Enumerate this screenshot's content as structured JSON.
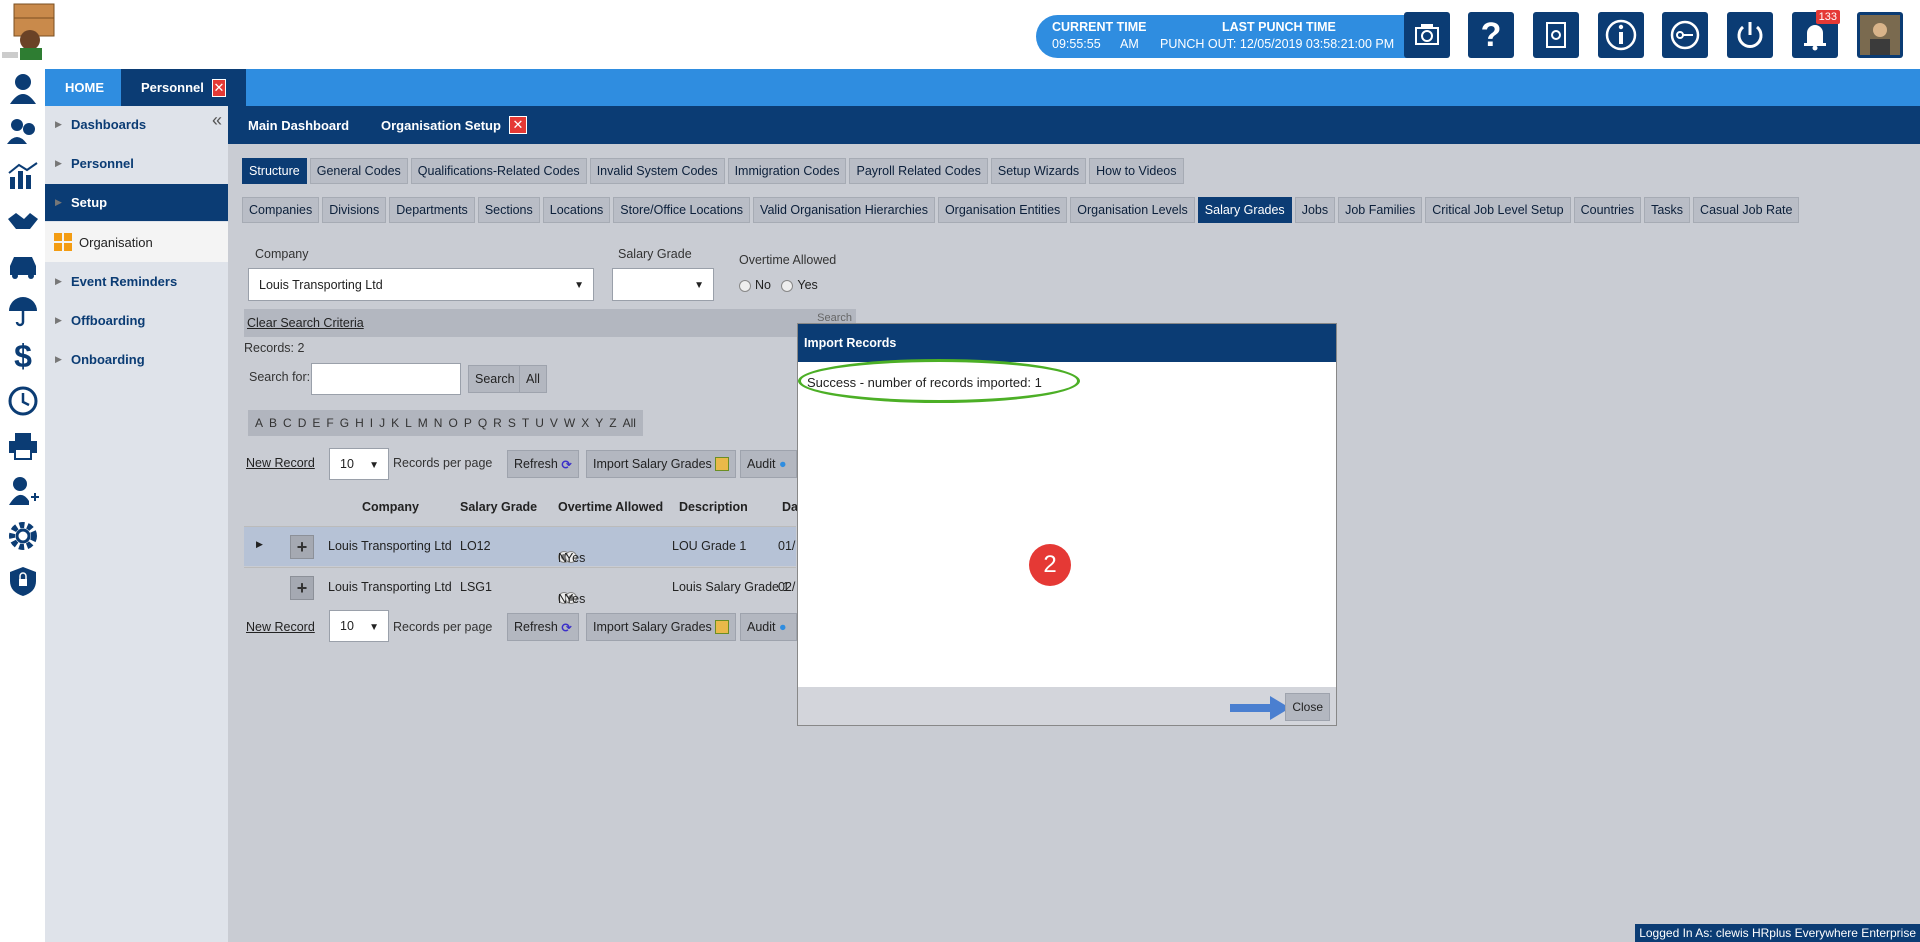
{
  "header": {
    "current_time_label": "CURRENT TIME",
    "current_time": "09:55:55",
    "current_ampm": "AM",
    "last_punch_label": "LAST PUNCH TIME",
    "last_punch": "PUNCH OUT: 12/05/2019 03:58:21:00 PM",
    "notification_count": "133"
  },
  "top_tabs": {
    "home": "HOME",
    "personnel": "Personnel"
  },
  "sidebar": {
    "items": [
      "Dashboards",
      "Personnel",
      "Setup",
      "Organisation",
      "Event Reminders",
      "Offboarding",
      "Onboarding"
    ]
  },
  "sub_tabs": {
    "main": "Main Dashboard",
    "org": "Organisation Setup"
  },
  "code_tabs": [
    "Structure",
    "General Codes",
    "Qualifications-Related Codes",
    "Invalid System Codes",
    "Immigration Codes",
    "Payroll Related Codes",
    "Setup Wizards",
    "How to Videos"
  ],
  "structure_tabs": [
    "Companies",
    "Divisions",
    "Departments",
    "Sections",
    "Locations",
    "Store/Office Locations",
    "Valid Organisation Hierarchies",
    "Organisation Entities",
    "Organisation Levels",
    "Salary Grades",
    "Jobs",
    "Job Families",
    "Critical Job Level Setup",
    "Countries",
    "Tasks",
    "Casual Job Rate"
  ],
  "filters": {
    "company_label": "Company",
    "company_value": "Louis Transporting Ltd",
    "grade_label": "Salary Grade",
    "overtime_label": "Overtime Allowed",
    "no": "No",
    "yes": "Yes",
    "clear": "Clear Search Criteria",
    "search_partial": "Search",
    "records": "Records:  2",
    "search_for": "Search for:",
    "search_btn": "Search",
    "all_btn": "All"
  },
  "alphabet": [
    "A",
    "B",
    "C",
    "D",
    "E",
    "F",
    "G",
    "H",
    "I",
    "J",
    "K",
    "L",
    "M",
    "N",
    "O",
    "P",
    "Q",
    "R",
    "S",
    "T",
    "U",
    "V",
    "W",
    "X",
    "Y",
    "Z",
    "All"
  ],
  "toolbar": {
    "new_record": "New Record",
    "per_page_value": "10",
    "per_page_label": "Records per page",
    "refresh": "Refresh",
    "import": "Import Salary Grades",
    "audit": "Audit"
  },
  "grid": {
    "headers": [
      "Company",
      "Salary Grade",
      "Overtime Allowed",
      "Description",
      "Da"
    ],
    "rows": [
      {
        "company": "Louis Transporting Ltd",
        "grade": "LO12",
        "no": "No",
        "yes": "Yes",
        "overtime": "No",
        "description": "LOU Grade 1",
        "date": "01/"
      },
      {
        "company": "Louis Transporting Ltd",
        "grade": "LSG1",
        "no": "No",
        "yes": "Yes",
        "overtime": "Yes",
        "description": "Louis Salary Grade 1",
        "date": "02/"
      }
    ]
  },
  "modal": {
    "title": "Import Records",
    "message": "Success - number of records imported: 1",
    "step": "2",
    "close": "Close"
  },
  "footer": {
    "logged_in": "Logged In As: clewis HRplus Everywhere Enterprise"
  },
  "colors": {
    "navy": "#0b3c74",
    "blue": "#2f8de0",
    "red": "#e53935",
    "green": "#4caf26"
  }
}
